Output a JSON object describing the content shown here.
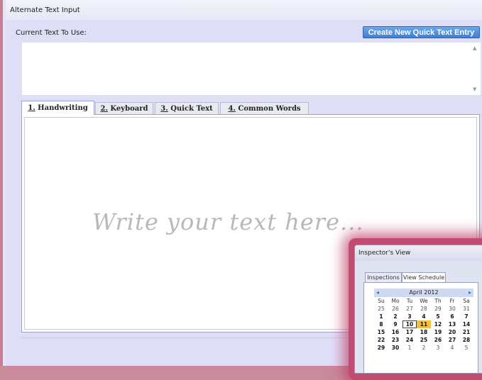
{
  "window": {
    "title": "Alternate Text Input"
  },
  "main": {
    "current_text_label": "Current Text To Use:",
    "create_button_label": "Create New Quick Text Entry",
    "current_text_value": "",
    "tabs": [
      {
        "num": "1.",
        "label": " Handwriting"
      },
      {
        "num": "2.",
        "label": " Keyboard"
      },
      {
        "num": "3.",
        "label": " Quick Text"
      },
      {
        "num": "4.",
        "label": " Common Words"
      }
    ],
    "active_tab": 0,
    "handwriting_placeholder": "Write your text here..."
  },
  "inspector": {
    "title": "Inspector's View",
    "tabs": [
      "Inspections",
      "View Schedule"
    ],
    "active_tab": 1,
    "calendar": {
      "month": "April 2012",
      "weekdays": [
        "Su",
        "Mo",
        "Tu",
        "We",
        "Th",
        "Fr",
        "Sa"
      ],
      "days": [
        [
          "25",
          "26",
          "27",
          "28",
          "29",
          "30",
          "31"
        ],
        [
          "1",
          "2",
          "3",
          "4",
          "5",
          "6",
          "7"
        ],
        [
          "8",
          "9",
          "10",
          "11",
          "12",
          "13",
          "14"
        ],
        [
          "15",
          "16",
          "17",
          "18",
          "19",
          "20",
          "21"
        ],
        [
          "22",
          "23",
          "24",
          "25",
          "26",
          "27",
          "28"
        ],
        [
          "29",
          "30",
          "1",
          "2",
          "3",
          "4",
          "5"
        ]
      ],
      "selected_day": "10",
      "today": "11"
    }
  },
  "colors": {
    "accent": "#3b7fd6",
    "today": "#f2bf40"
  }
}
